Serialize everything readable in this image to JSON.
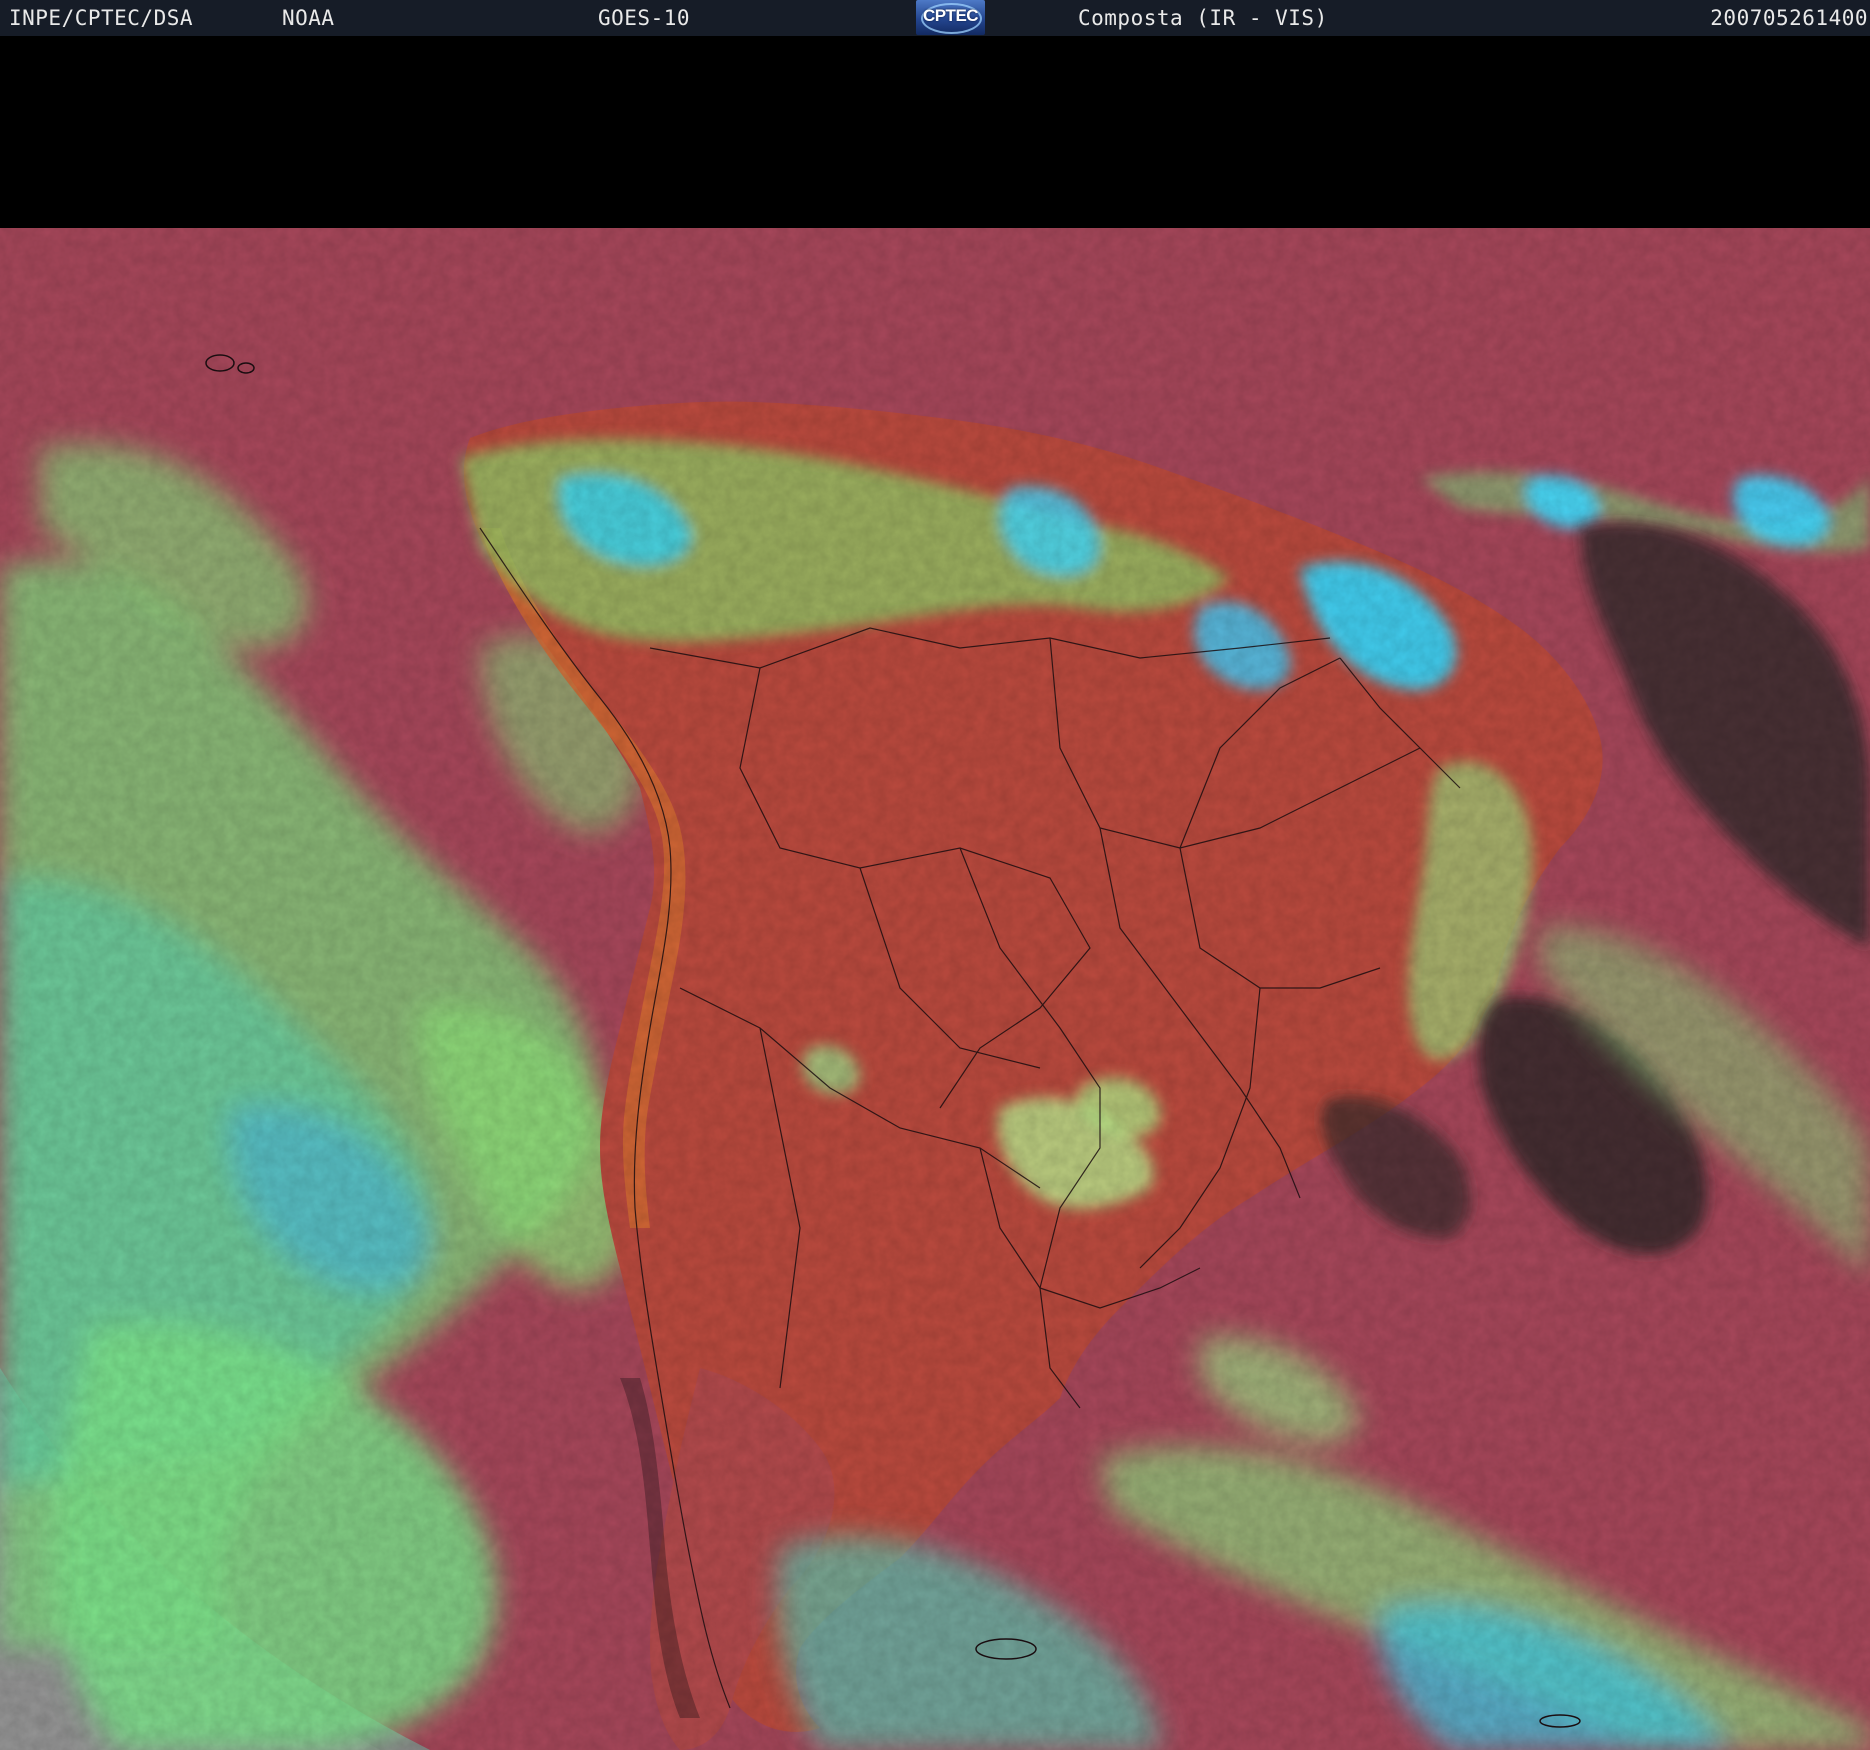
{
  "header": {
    "source": "INPE/CPTEC/DSA",
    "agency": "NOAA",
    "satellite": "GOES-10",
    "logo_text": "CPTEC",
    "product": "Composta (IR - VIS)",
    "timestamp": "200705261400"
  },
  "image": {
    "subject": "South America satellite composite (IR - VIS)",
    "palette": {
      "land_clear": "#b8453e",
      "ocean_clear": "#a2485a",
      "low_cloud": "#8fe07a",
      "mid_cloud": "#55c6b6",
      "high_cloud": "#39d8ff",
      "space_dark": "#232323",
      "outside_disk": "#8a8a8a",
      "border_lines": "#1a0d10"
    }
  }
}
